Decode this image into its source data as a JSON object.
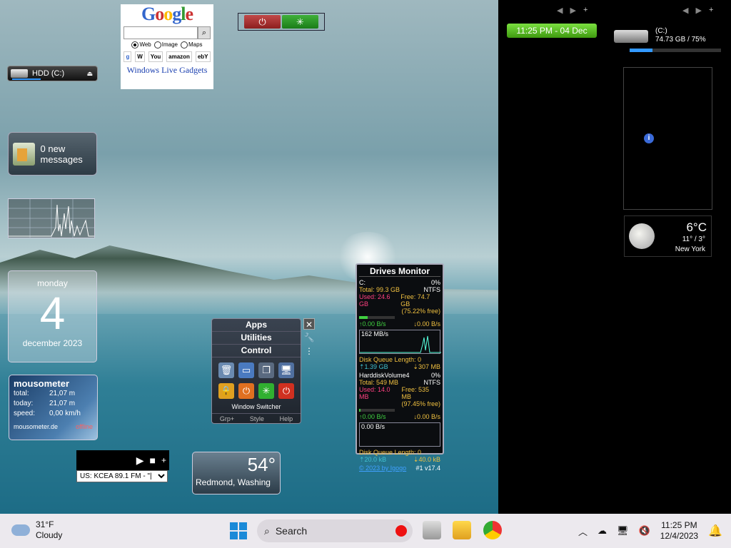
{
  "google": {
    "logo": "Google",
    "search_value": "",
    "radios": [
      "Web",
      "Image",
      "Maps"
    ],
    "sites": [
      "W",
      "You",
      "amazon",
      "ebY"
    ],
    "footer": "Windows Live Gadgets"
  },
  "hdd": {
    "label": "HDD (C:)"
  },
  "mail": {
    "text": "0 new messages"
  },
  "calendar": {
    "day": "monday",
    "date": "4",
    "month_year": "december 2023"
  },
  "mousometer": {
    "title": "mousometer",
    "rows": [
      {
        "key": "total:",
        "value": "21,07 m"
      },
      {
        "key": "today:",
        "value": "21,07 m"
      },
      {
        "key": "speed:",
        "value": "0,00 km/h"
      }
    ],
    "site": "mousometer.de",
    "status": "offline"
  },
  "radio": {
    "station": "US: KCEA 89.1 FM - \"|"
  },
  "weather_small": {
    "temp": "54°",
    "city": "Redmond, Washing"
  },
  "apps_gadget": {
    "tabs": [
      "Apps",
      "Utilities",
      "Control"
    ],
    "caption": "Window Switcher",
    "footer": [
      "Grp+",
      "Style",
      "Help"
    ]
  },
  "drives_monitor": {
    "title": "Drives Monitor",
    "drive1": {
      "name": "C:",
      "pct": "0%",
      "total": "Total: 99.3 GB",
      "fs": "NTFS",
      "used": "Used: 24.6 GB",
      "free": "Free: 74.7 GB",
      "free_pct": "(75.22% free)",
      "read": "0.00 B/s",
      "write": "0.00 B/s",
      "chart_label": "162 MB/s",
      "queue": "Disk Queue Length: 0",
      "r_total": "1.39 GB",
      "w_total": "307 MB"
    },
    "drive2": {
      "name": "HarddiskVolume4",
      "pct": "0%",
      "total": "Total: 549 MB",
      "fs": "NTFS",
      "used": "Used: 14.0 MB",
      "free": "Free: 535 MB",
      "free_pct": "(97.45% free)",
      "read": "0.00 B/s",
      "write": "0.00 B/s",
      "chart_label": "0.00 B/s",
      "queue": "Disk Queue Length: 0",
      "r_total": "20.0 kB",
      "w_total": "40.0 kB"
    },
    "footer_link": "© 2023 by Igogo",
    "footer_ver": "#1 v17.4"
  },
  "right_panel": {
    "clock": "11:25 PM - 04 Dec",
    "drive_name": "(C:)",
    "drive_info": "74.73 GB / 75%",
    "weather": {
      "temp": "6°C",
      "hilo": "11° / 3°",
      "city": "New York"
    }
  },
  "taskbar": {
    "weather_temp": "31°F",
    "weather_desc": "Cloudy",
    "search_placeholder": "Search",
    "time": "11:25 PM",
    "date": "12/4/2023"
  }
}
